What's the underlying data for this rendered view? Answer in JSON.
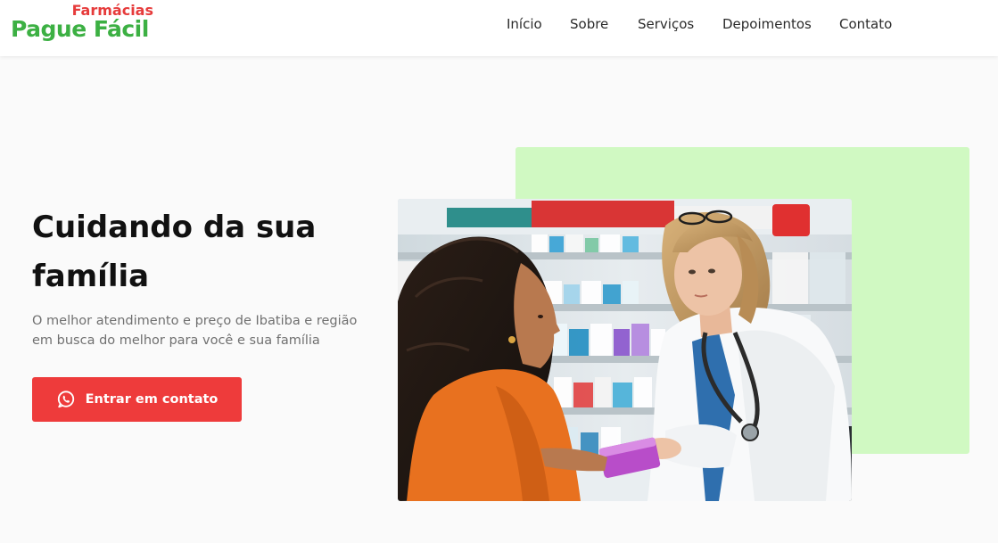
{
  "header": {
    "logo": {
      "top": "Farmácias",
      "bottom": "Pague Fácil"
    },
    "nav": [
      {
        "label": "Início"
      },
      {
        "label": "Sobre"
      },
      {
        "label": "Serviços"
      },
      {
        "label": "Depoimentos"
      },
      {
        "label": "Contato"
      }
    ]
  },
  "hero": {
    "title": "Cuidando da sua família",
    "subtitle": "O melhor atendimento e preço de Ibatiba e região em busca do melhor para você e sua família",
    "cta_label": "Entrar em contato",
    "cta_icon": "whatsapp-icon",
    "image_alt": "Farmacêutica atendendo cliente em farmácia"
  },
  "colors": {
    "brand_red": "#ee3b3b",
    "brand_green": "#3cb043",
    "accent_green_block": "#d0f9c2"
  }
}
